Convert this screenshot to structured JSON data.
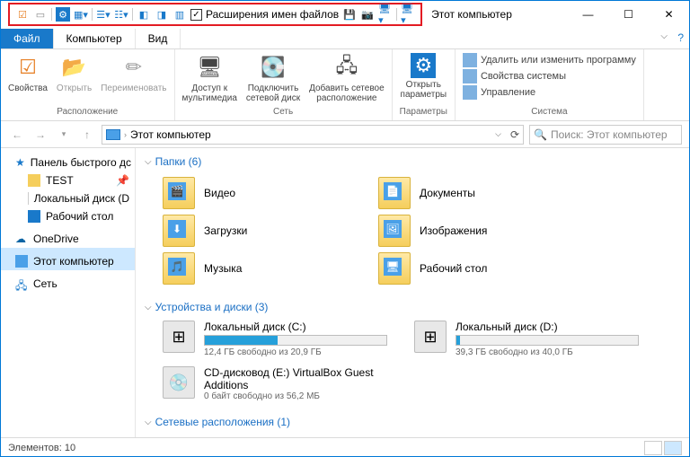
{
  "title": "Этот компьютер",
  "qat_items": [
    "props",
    "open",
    "settings",
    "list",
    "details",
    "tiles",
    "pane1",
    "pane2",
    "pane3"
  ],
  "qat_checkbox_label": "Расширения имен файлов",
  "qat_checkbox_checked": true,
  "tabs": {
    "file": "Файл",
    "computer": "Компьютер",
    "view": "Вид"
  },
  "ribbon": {
    "group1": {
      "label": "Расположение",
      "btns": [
        "Свойства",
        "Открыть",
        "Переименовать"
      ]
    },
    "group2": {
      "label": "Сеть",
      "btns": [
        "Доступ к\nмультимедиа",
        "Подключить\nсетевой диск",
        "Добавить сетевое\nрасположение"
      ]
    },
    "group3": {
      "label": "Параметры",
      "btn": "Открыть\nпараметры"
    },
    "group4": {
      "label": "Система",
      "items": [
        "Удалить или изменить программу",
        "Свойства системы",
        "Управление"
      ]
    }
  },
  "address": {
    "path": "Этот компьютер",
    "search_placeholder": "Поиск: Этот компьютер"
  },
  "nav": {
    "quick": "Панель быстрого дс",
    "quick_items": [
      "TEST",
      "Локальный диск (D",
      "Рабочий стол"
    ],
    "onedrive": "OneDrive",
    "thispc": "Этот компьютер",
    "network": "Сеть"
  },
  "sections": {
    "folders": {
      "title": "Папки (6)",
      "items": [
        "Видео",
        "Документы",
        "Загрузки",
        "Изображения",
        "Музыка",
        "Рабочий стол"
      ]
    },
    "drives": {
      "title": "Устройства и диски (3)",
      "items": [
        {
          "name": "Локальный диск (C:)",
          "free": "12,4 ГБ свободно из 20,9 ГБ",
          "pct": 40
        },
        {
          "name": "Локальный диск (D:)",
          "free": "39,3 ГБ свободно из 40,0 ГБ",
          "pct": 2
        },
        {
          "name": "CD-дисковод (E:) VirtualBox Guest Additions",
          "free": "0 байт свободно из 56,2 МБ",
          "cd": true
        }
      ]
    },
    "network": {
      "title": "Сетевые расположения (1)"
    }
  },
  "status": {
    "items": "Элементов: 10"
  }
}
